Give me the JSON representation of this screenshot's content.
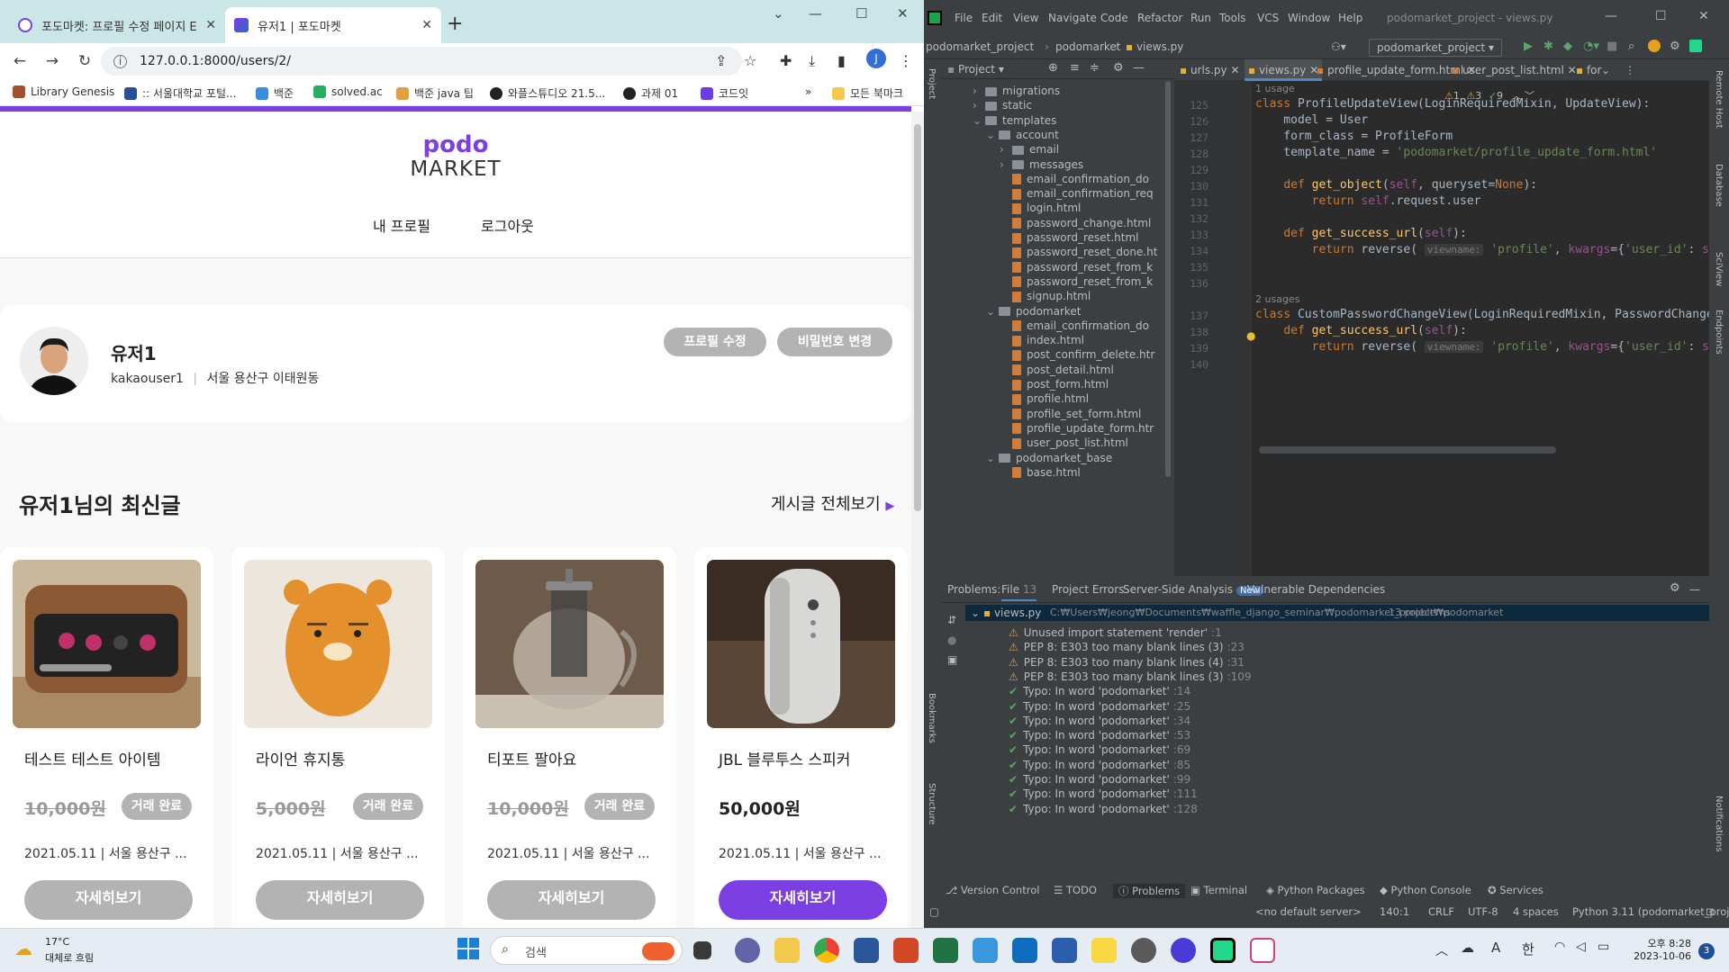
{
  "browser": {
    "tabs": [
      {
        "title": "포도마켓: 프로필 수정 페이지 E",
        "active": false
      },
      {
        "title": "유저1 | 포도마켓",
        "active": true
      }
    ],
    "url": "127.0.0.1:8000/users/2/",
    "avatar_letter": "J",
    "bookmarks": [
      "Library Genesis",
      ":: 서울대학교 포털...",
      "백준",
      "solved.ac",
      "백준 java 팁",
      "와플스튜디오 21.5...",
      "과제 01",
      "코드잇"
    ],
    "bookmarks_more": "»",
    "bookmarks_folder": "모든 북마크"
  },
  "site": {
    "logo_top": "podo",
    "logo_bottom": "MARKET",
    "nav": [
      "내 프로필",
      "로그아웃"
    ],
    "profile": {
      "name": "유저1",
      "username": "kakaouser1",
      "location": "서울 용산구 이태원동",
      "edit_button": "프로필 수정",
      "password_button": "비밀번호 변경"
    },
    "section_title": "유저1님의 최신글",
    "see_all": "게시글 전체보기",
    "posts": [
      {
        "title": "테스트 테스트 아이템",
        "price": "10,000원",
        "sold": true,
        "badge": "거래 완료",
        "meta": "2021.05.11 | 서울 용산구 ...",
        "button": "자세히보기"
      },
      {
        "title": "라이언 휴지통",
        "price": "5,000원",
        "sold": true,
        "badge": "거래 완료",
        "meta": "2021.05.11 | 서울 용산구 ...",
        "button": "자세히보기"
      },
      {
        "title": "티포트 팔아요",
        "price": "10,000원",
        "sold": true,
        "badge": "거래 완료",
        "meta": "2021.05.11 | 서울 용산구 ...",
        "button": "자세히보기"
      },
      {
        "title": "JBL 블루투스 스피커",
        "price": "50,000원",
        "sold": false,
        "badge": "",
        "meta": "2021.05.11 | 서울 용산구 ...",
        "button": "자세히보기"
      }
    ],
    "accent": "#7b3fe4"
  },
  "ide": {
    "menu": [
      "File",
      "Edit",
      "View",
      "Navigate",
      "Code",
      "Refactor",
      "Run",
      "Tools",
      "VCS",
      "Window",
      "Help"
    ],
    "window_title": "podomarket_project - views.py",
    "breadcrumb": [
      "podomarket_project",
      "podomarket",
      "views.py"
    ],
    "run_config": "podomarket_project",
    "project_label": "Project",
    "editor_tabs": [
      "urls.py",
      "views.py",
      "profile_update_form.html",
      "user_post_list.html",
      "for"
    ],
    "inspections": {
      "warnings": "1",
      "weak": "3",
      "ok": "9"
    },
    "tree": [
      {
        "name": "migrations",
        "type": "folder",
        "depth": 2,
        "arrow": "›"
      },
      {
        "name": "static",
        "type": "folder",
        "depth": 2,
        "arrow": "›"
      },
      {
        "name": "templates",
        "type": "folder",
        "depth": 2,
        "arrow": "⌄"
      },
      {
        "name": "account",
        "type": "folder",
        "depth": 3,
        "arrow": "⌄"
      },
      {
        "name": "email",
        "type": "folder",
        "depth": 4,
        "arrow": "›"
      },
      {
        "name": "messages",
        "type": "folder",
        "depth": 4,
        "arrow": "›"
      },
      {
        "name": "email_confirmation_do",
        "type": "html",
        "depth": 4,
        "arrow": ""
      },
      {
        "name": "email_confirmation_req",
        "type": "html",
        "depth": 4,
        "arrow": ""
      },
      {
        "name": "login.html",
        "type": "html",
        "depth": 4,
        "arrow": ""
      },
      {
        "name": "password_change.html",
        "type": "html",
        "depth": 4,
        "arrow": ""
      },
      {
        "name": "password_reset.html",
        "type": "html",
        "depth": 4,
        "arrow": ""
      },
      {
        "name": "password_reset_done.ht",
        "type": "html",
        "depth": 4,
        "arrow": ""
      },
      {
        "name": "password_reset_from_k",
        "type": "html",
        "depth": 4,
        "arrow": ""
      },
      {
        "name": "password_reset_from_k",
        "type": "html",
        "depth": 4,
        "arrow": ""
      },
      {
        "name": "signup.html",
        "type": "html",
        "depth": 4,
        "arrow": ""
      },
      {
        "name": "podomarket",
        "type": "folder",
        "depth": 3,
        "arrow": "⌄"
      },
      {
        "name": "email_confirmation_do",
        "type": "html",
        "depth": 4,
        "arrow": ""
      },
      {
        "name": "index.html",
        "type": "html",
        "depth": 4,
        "arrow": ""
      },
      {
        "name": "post_confirm_delete.htr",
        "type": "html",
        "depth": 4,
        "arrow": ""
      },
      {
        "name": "post_detail.html",
        "type": "html",
        "depth": 4,
        "arrow": ""
      },
      {
        "name": "post_form.html",
        "type": "html",
        "depth": 4,
        "arrow": ""
      },
      {
        "name": "profile.html",
        "type": "html",
        "depth": 4,
        "arrow": ""
      },
      {
        "name": "profile_set_form.html",
        "type": "html",
        "depth": 4,
        "arrow": ""
      },
      {
        "name": "profile_update_form.htr",
        "type": "html",
        "depth": 4,
        "arrow": ""
      },
      {
        "name": "user_post_list.html",
        "type": "html",
        "depth": 4,
        "arrow": ""
      },
      {
        "name": "podomarket_base",
        "type": "folder",
        "depth": 3,
        "arrow": "⌄"
      },
      {
        "name": "base.html",
        "type": "html",
        "depth": 4,
        "arrow": ""
      }
    ],
    "problems_tabs": [
      "Problems:",
      "File",
      "13",
      "Project Errors",
      "Server-Side Analysis",
      "New",
      "Vulnerable Dependencies"
    ],
    "problems_file": "views.py",
    "problems_path": "C:₩Users₩jeong₩Documents₩waffle_django_seminar₩podomarket_project₩podomarket",
    "problems_count": "13 problems",
    "problems": [
      {
        "kind": "warn",
        "text": "Unused import statement 'render'",
        "line": ":1"
      },
      {
        "kind": "warn",
        "text": "PEP 8: E303 too many blank lines (3)",
        "line": ":23"
      },
      {
        "kind": "warn",
        "text": "PEP 8: E303 too many blank lines (4)",
        "line": ":31"
      },
      {
        "kind": "warn",
        "text": "PEP 8: E303 too many blank lines (3)",
        "line": ":109"
      },
      {
        "kind": "typo",
        "text": "Typo: In word 'podomarket'",
        "line": ":14"
      },
      {
        "kind": "typo",
        "text": "Typo: In word 'podomarket'",
        "line": ":25"
      },
      {
        "kind": "typo",
        "text": "Typo: In word 'podomarket'",
        "line": ":34"
      },
      {
        "kind": "typo",
        "text": "Typo: In word 'podomarket'",
        "line": ":53"
      },
      {
        "kind": "typo",
        "text": "Typo: In word 'podomarket'",
        "line": ":69"
      },
      {
        "kind": "typo",
        "text": "Typo: In word 'podomarket'",
        "line": ":85"
      },
      {
        "kind": "typo",
        "text": "Typo: In word 'podomarket'",
        "line": ":99"
      },
      {
        "kind": "typo",
        "text": "Typo: In word 'podomarket'",
        "line": ":111"
      },
      {
        "kind": "typo",
        "text": "Typo: In word 'podomarket'",
        "line": ":128"
      }
    ],
    "tool_tabs": [
      "Version Control",
      "TODO",
      "Problems",
      "Terminal",
      "Python Packages",
      "Python Console",
      "Services"
    ],
    "status": [
      "<no default server>",
      "140:1",
      "CRLF",
      "UTF-8",
      "4 spaces",
      "Python 3.11 (podomarket_project)"
    ],
    "side_left": [
      "Project",
      "Bookmarks",
      "Structure"
    ],
    "side_right": [
      "Remote Host",
      "Database",
      "SciView",
      "Endpoints",
      "Notifications"
    ]
  },
  "taskbar": {
    "temp": "17°C",
    "weather": "대체로 흐림",
    "search": "검색",
    "time": "오후 8:28",
    "date": "2023-10-06",
    "ime": "한",
    "notif_count": "3"
  }
}
